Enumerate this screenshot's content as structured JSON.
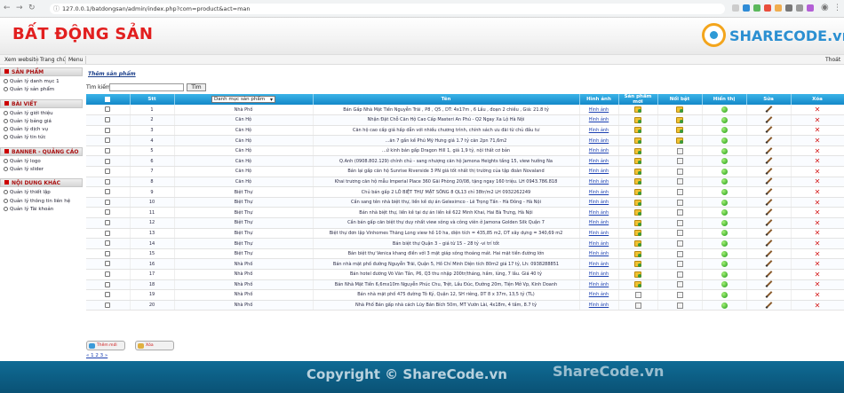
{
  "browser": {
    "url": "127.0.0.1/batdongsan/admin/index.php?com=product&act=man"
  },
  "header": {
    "site_title": "BẤT ĐỘNG SẢN",
    "logo_text": "SHARECODE.vn"
  },
  "topnav": {
    "items": [
      "Xem website",
      "Trang chủ",
      "Menu"
    ],
    "logout": "Thoát"
  },
  "sidebar": {
    "groups": [
      {
        "title": "SẢN PHẨM",
        "items": [
          "Quản lý danh mục 1",
          "Quản lý sản phẩm"
        ]
      },
      {
        "title": "BÀI VIẾT",
        "items": [
          "Quản lý giới thiệu",
          "Quản lý bảng giá",
          "Quản lý dịch vụ",
          "Quản lý tin tức"
        ]
      },
      {
        "title": "BANNER - QUẢNG CÁO",
        "items": [
          "Quản lý logo",
          "Quản lý slider"
        ]
      },
      {
        "title": "NỘI DUNG KHÁC",
        "items": [
          "Quản lý thiết lập",
          "Quản lý thông tin liên hệ",
          "Quản lý Tài khoản"
        ]
      }
    ]
  },
  "main": {
    "add_link": "Thêm sản phẩm",
    "search_label": "Tìm kiếm:",
    "search_button": "Tìm",
    "category_select": "Danh mục sản phẩm",
    "columns": [
      "",
      "Stt",
      "",
      "Tên",
      "Hình ảnh",
      "Sản phẩm mới",
      "Nổi bật",
      "Hiển thị",
      "Sửa",
      "Xóa"
    ],
    "rows": [
      {
        "stt": "1",
        "cat": "Nhà Phố",
        "name": "Bán Gấp Nhà Mặt Tiền Nguyễn Trãi , P8 , Q5 , DT: 4x17m , 6 Lầu , đoạn 2 chiều , Giá: 21.8 tỷ",
        "img": "Hình ảnh",
        "new": true,
        "hot": true
      },
      {
        "stt": "2",
        "cat": "Căn Hộ",
        "name": "Nhận Đặt Chỗ Căn Hộ Cao Cấp Masteri An Phú - Q2 Ngay Xa Lộ Hà Nội",
        "img": "Hình ảnh",
        "new": true,
        "hot": true
      },
      {
        "stt": "3",
        "cat": "Căn Hộ",
        "name": "Căn hộ cao cấp giá hấp dẫn với nhiều chương trình, chính sách ưu đãi từ chủ đầu tư",
        "img": "Hình ảnh",
        "new": true,
        "hot": true
      },
      {
        "stt": "4",
        "cat": "Căn Hộ",
        "name": "...ăn 7 gần kề Phú Mỹ Hưng giá 1.7 tỷ căn 2pn 71,6m2",
        "img": "Hình ảnh",
        "new": true,
        "hot": true
      },
      {
        "stt": "5",
        "cat": "Căn Hộ",
        "name": "...ứ kinh bán gấp Dragon Hill 1, giá 1,9 tỷ, nội thất cơ bản",
        "img": "Hình ảnh",
        "new": true,
        "hot": false
      },
      {
        "stt": "6",
        "cat": "Căn Hộ",
        "name": "Q.Anh (0908.802.129) chính chủ - sang nhượng căn hộ Jamona Heights tầng 15, view hướng Na",
        "img": "Hình ảnh",
        "new": true,
        "hot": false
      },
      {
        "stt": "7",
        "cat": "Căn Hộ",
        "name": "Bán lại gấp căn hộ Sunrise Riverside 3 PN giá tốt nhất thị trường của tập đoàn Novaland",
        "img": "Hình ảnh",
        "new": true,
        "hot": false
      },
      {
        "stt": "8",
        "cat": "Căn Hộ",
        "name": "Khai trương căn hộ mẫu Imperial Place 360 Gãi Phòng 20/08, tặng ngay 160 triệu. LH 0943.786.818",
        "img": "Hình ảnh",
        "new": true,
        "hot": false
      },
      {
        "stt": "9",
        "cat": "Biệt Thự",
        "name": "Chủ bán gấp 2 LÔ BIỆT THỰ MẶT SÔNG 8 QL13 chỉ 38tr/m2 LH 0932262249",
        "img": "Hình ảnh",
        "new": true,
        "hot": false
      },
      {
        "stt": "10",
        "cat": "Biệt Thự",
        "name": "Cần sang tên nhà biệt thự, liền kề dự án Geleximco - Lê Trọng Tấn - Hà Đông - Hà Nội",
        "img": "Hình ảnh",
        "new": true,
        "hot": false
      },
      {
        "stt": "11",
        "cat": "Biệt Thự",
        "name": "Bán nhà biệt thự, liền kề tại dự án liền kề 622 Minh Khai, Hai Bà Trưng, Hà Nội",
        "img": "Hình ảnh",
        "new": true,
        "hot": false
      },
      {
        "stt": "12",
        "cat": "Biệt Thự",
        "name": "Cần bán gấp căn biệt thự duy nhất view sông và công viên ở Jamona Golden Silk Quận 7",
        "img": "Hình ảnh",
        "new": true,
        "hot": false
      },
      {
        "stt": "13",
        "cat": "Biệt Thự",
        "name": "Biệt thự đơn lập Vinhomes Thăng Long view hồ 10 ha, diện tích = 435,85 m2, DT xây dựng = 340,69 m2",
        "img": "Hình ảnh",
        "new": true,
        "hot": false
      },
      {
        "stt": "14",
        "cat": "Biệt Thự",
        "name": "Bán biệt thự Quận 3 – giá từ 15 – 28 tỷ -vi trí tốt",
        "img": "Hình ảnh",
        "new": true,
        "hot": false
      },
      {
        "stt": "15",
        "cat": "Biệt Thự",
        "name": "Bán biệt thự Venica khang điền với 3 mặt giáp sông thoáng mát. Hai mặt tiền đường lớn",
        "img": "Hình ảnh",
        "new": true,
        "hot": false
      },
      {
        "stt": "16",
        "cat": "Nhà Phố",
        "name": "Bán nhà mặt phố đường Nguyễn Trãi, Quận 5, Hồ Chí Minh Diện tích 80m2 giá 17 tỷ, Lh: 0938288851",
        "img": "Hình ảnh",
        "new": true,
        "hot": false
      },
      {
        "stt": "17",
        "cat": "Nhà Phố",
        "name": "Bán hotel đường Võ Văn Tần, P6, Q3 thu nhập 200tr/tháng, hầm, lửng, 7 lầu. Giá 40 tỷ",
        "img": "Hình ảnh",
        "new": true,
        "hot": false
      },
      {
        "stt": "18",
        "cat": "Nhà Phố",
        "name": "Bán Nhà Mặt Tiền 6,6mx10m Nguyễn Phúc Chu, Trệt, Lầu Đúc, Đường 20m, Tiện Mở Vp, Kinh Doanh",
        "img": "Hình ảnh",
        "new": true,
        "hot": false
      },
      {
        "stt": "19",
        "cat": "Nhà Phố",
        "name": "Bán nhà mặt phố 475 đường Tô Ký, Quận 12, SH riêng, DT 8 x 37m, 13,5 tỷ (TL)",
        "img": "Hình ảnh",
        "new": false,
        "hot": false
      },
      {
        "stt": "20",
        "cat": "Nhà Phố",
        "name": "Nhà Phố Bán gấp nhà cách Lũy Bán Bích 50m, MT Vườn Lài, 4x18m, 4 tầm, 8.7 tỷ",
        "img": "Hình ảnh",
        "new": false,
        "hot": false
      }
    ],
    "bottom_buttons": [
      "Thêm mới",
      "Xóa"
    ],
    "pager": "« 1 2 3 »"
  },
  "footer": {
    "copyright": "Copyright © ShareCode.vn",
    "watermark": "ShareCode.vn"
  }
}
